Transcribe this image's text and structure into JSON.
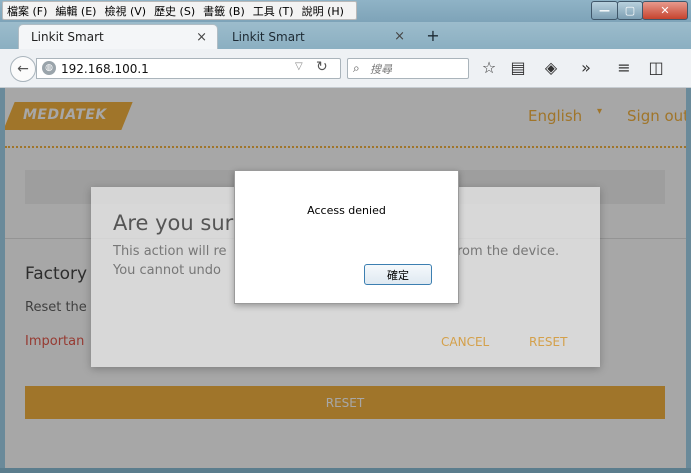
{
  "menubar": {
    "items": [
      "檔案 (F)",
      "編輯 (E)",
      "檢視 (V)",
      "歷史 (S)",
      "書籤 (B)",
      "工具 (T)",
      "說明 (H)"
    ]
  },
  "window_controls": {
    "minimize": "—",
    "maximize": "▢",
    "close": "✕"
  },
  "tabs": [
    {
      "title": "Linkit Smart",
      "close": "×"
    },
    {
      "title": "Linkit Smart",
      "close": "×"
    }
  ],
  "new_tab": "+",
  "navbar": {
    "back": "←",
    "url": "192.168.100.1",
    "search_placeholder": "搜尋",
    "icons": {
      "bookmark": "☆",
      "reader": "▤",
      "pocket": "◈",
      "overflow": "»",
      "menu": "≡",
      "extension": "◫"
    }
  },
  "page": {
    "logo": "MEDIATEK",
    "language": "English",
    "language_caret": "▾",
    "signout": "Sign out",
    "factory_title": "Factory",
    "reset_text": "Reset the",
    "important_text": "Importan",
    "reset_button": "RESET"
  },
  "confirm_dialog": {
    "title": "Are you sure",
    "line1": "This action will re",
    "line1b": "rom the device.",
    "line2": "You cannot undo",
    "cancel": "CANCEL",
    "reset": "RESET"
  },
  "alert": {
    "message": "Access denied",
    "ok": "確定"
  },
  "colors": {
    "accent": "#f3a51c",
    "important": "#e03a2a"
  }
}
